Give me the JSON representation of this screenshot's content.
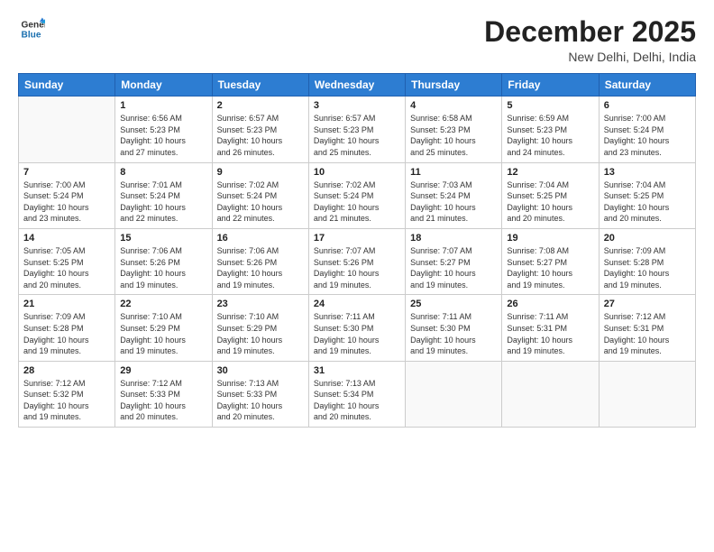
{
  "header": {
    "logo_line1": "General",
    "logo_line2": "Blue",
    "month": "December 2025",
    "location": "New Delhi, Delhi, India"
  },
  "weekdays": [
    "Sunday",
    "Monday",
    "Tuesday",
    "Wednesday",
    "Thursday",
    "Friday",
    "Saturday"
  ],
  "weeks": [
    [
      {
        "day": "",
        "info": ""
      },
      {
        "day": "1",
        "info": "Sunrise: 6:56 AM\nSunset: 5:23 PM\nDaylight: 10 hours\nand 27 minutes."
      },
      {
        "day": "2",
        "info": "Sunrise: 6:57 AM\nSunset: 5:23 PM\nDaylight: 10 hours\nand 26 minutes."
      },
      {
        "day": "3",
        "info": "Sunrise: 6:57 AM\nSunset: 5:23 PM\nDaylight: 10 hours\nand 25 minutes."
      },
      {
        "day": "4",
        "info": "Sunrise: 6:58 AM\nSunset: 5:23 PM\nDaylight: 10 hours\nand 25 minutes."
      },
      {
        "day": "5",
        "info": "Sunrise: 6:59 AM\nSunset: 5:23 PM\nDaylight: 10 hours\nand 24 minutes."
      },
      {
        "day": "6",
        "info": "Sunrise: 7:00 AM\nSunset: 5:24 PM\nDaylight: 10 hours\nand 23 minutes."
      }
    ],
    [
      {
        "day": "7",
        "info": "Sunrise: 7:00 AM\nSunset: 5:24 PM\nDaylight: 10 hours\nand 23 minutes."
      },
      {
        "day": "8",
        "info": "Sunrise: 7:01 AM\nSunset: 5:24 PM\nDaylight: 10 hours\nand 22 minutes."
      },
      {
        "day": "9",
        "info": "Sunrise: 7:02 AM\nSunset: 5:24 PM\nDaylight: 10 hours\nand 22 minutes."
      },
      {
        "day": "10",
        "info": "Sunrise: 7:02 AM\nSunset: 5:24 PM\nDaylight: 10 hours\nand 21 minutes."
      },
      {
        "day": "11",
        "info": "Sunrise: 7:03 AM\nSunset: 5:24 PM\nDaylight: 10 hours\nand 21 minutes."
      },
      {
        "day": "12",
        "info": "Sunrise: 7:04 AM\nSunset: 5:25 PM\nDaylight: 10 hours\nand 20 minutes."
      },
      {
        "day": "13",
        "info": "Sunrise: 7:04 AM\nSunset: 5:25 PM\nDaylight: 10 hours\nand 20 minutes."
      }
    ],
    [
      {
        "day": "14",
        "info": "Sunrise: 7:05 AM\nSunset: 5:25 PM\nDaylight: 10 hours\nand 20 minutes."
      },
      {
        "day": "15",
        "info": "Sunrise: 7:06 AM\nSunset: 5:26 PM\nDaylight: 10 hours\nand 19 minutes."
      },
      {
        "day": "16",
        "info": "Sunrise: 7:06 AM\nSunset: 5:26 PM\nDaylight: 10 hours\nand 19 minutes."
      },
      {
        "day": "17",
        "info": "Sunrise: 7:07 AM\nSunset: 5:26 PM\nDaylight: 10 hours\nand 19 minutes."
      },
      {
        "day": "18",
        "info": "Sunrise: 7:07 AM\nSunset: 5:27 PM\nDaylight: 10 hours\nand 19 minutes."
      },
      {
        "day": "19",
        "info": "Sunrise: 7:08 AM\nSunset: 5:27 PM\nDaylight: 10 hours\nand 19 minutes."
      },
      {
        "day": "20",
        "info": "Sunrise: 7:09 AM\nSunset: 5:28 PM\nDaylight: 10 hours\nand 19 minutes."
      }
    ],
    [
      {
        "day": "21",
        "info": "Sunrise: 7:09 AM\nSunset: 5:28 PM\nDaylight: 10 hours\nand 19 minutes."
      },
      {
        "day": "22",
        "info": "Sunrise: 7:10 AM\nSunset: 5:29 PM\nDaylight: 10 hours\nand 19 minutes."
      },
      {
        "day": "23",
        "info": "Sunrise: 7:10 AM\nSunset: 5:29 PM\nDaylight: 10 hours\nand 19 minutes."
      },
      {
        "day": "24",
        "info": "Sunrise: 7:11 AM\nSunset: 5:30 PM\nDaylight: 10 hours\nand 19 minutes."
      },
      {
        "day": "25",
        "info": "Sunrise: 7:11 AM\nSunset: 5:30 PM\nDaylight: 10 hours\nand 19 minutes."
      },
      {
        "day": "26",
        "info": "Sunrise: 7:11 AM\nSunset: 5:31 PM\nDaylight: 10 hours\nand 19 minutes."
      },
      {
        "day": "27",
        "info": "Sunrise: 7:12 AM\nSunset: 5:31 PM\nDaylight: 10 hours\nand 19 minutes."
      }
    ],
    [
      {
        "day": "28",
        "info": "Sunrise: 7:12 AM\nSunset: 5:32 PM\nDaylight: 10 hours\nand 19 minutes."
      },
      {
        "day": "29",
        "info": "Sunrise: 7:12 AM\nSunset: 5:33 PM\nDaylight: 10 hours\nand 20 minutes."
      },
      {
        "day": "30",
        "info": "Sunrise: 7:13 AM\nSunset: 5:33 PM\nDaylight: 10 hours\nand 20 minutes."
      },
      {
        "day": "31",
        "info": "Sunrise: 7:13 AM\nSunset: 5:34 PM\nDaylight: 10 hours\nand 20 minutes."
      },
      {
        "day": "",
        "info": ""
      },
      {
        "day": "",
        "info": ""
      },
      {
        "day": "",
        "info": ""
      }
    ]
  ]
}
